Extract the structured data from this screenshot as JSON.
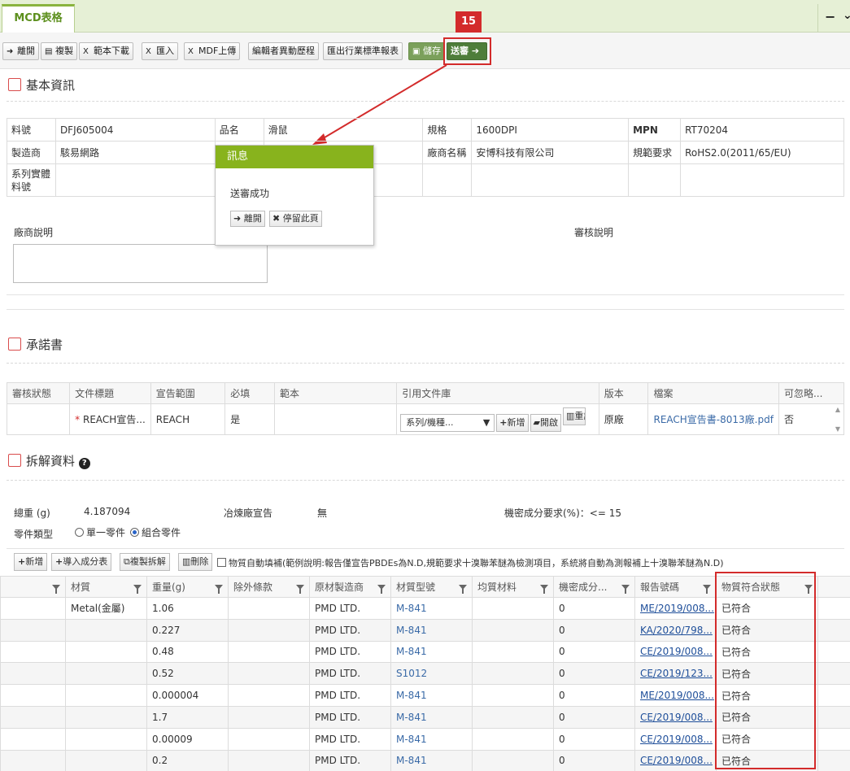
{
  "tab": {
    "title": "MCD表格",
    "minimize": "−",
    "more": "⌄"
  },
  "toolbar": {
    "leave": "離開",
    "copy": "複製",
    "template_download": "範本下載",
    "import": "匯入",
    "mdf_upload": "MDF上傳",
    "edit_history": "編輯者異動歷程",
    "export_industry": "匯出行業標準報表",
    "save": "儲存",
    "submit": "送審",
    "step_badge": "15"
  },
  "basic": {
    "title": "基本資訊",
    "part_no_label": "料號",
    "part_no": "DFJ605004",
    "name_label": "品名",
    "name": "滑鼠",
    "spec_label": "規格",
    "spec": "1600DPI",
    "mpn_label": "MPN",
    "mpn": "RT70204",
    "maker_label": "製造商",
    "maker": "駭易網路",
    "vendor_label": "廠商名稱",
    "vendor": "安博科技有限公司",
    "reg_label": "規範要求",
    "reg": "RoHS2.0(2011/65/EU)",
    "series_label": "系列實體料號",
    "vendor_note_label": "廠商說明",
    "review_note_label": "審核說明"
  },
  "popup": {
    "title": "訊息",
    "message": "送審成功",
    "leave": "離開",
    "stay": "停留此頁"
  },
  "commit": {
    "title": "承諾書",
    "headers": [
      "審核狀態",
      "文件標題",
      "宣告範圍",
      "必填",
      "範本",
      "引用文件庫",
      "版本",
      "檔案",
      "可忽略..."
    ],
    "row": {
      "status": "",
      "doc_title": "REACH宣告...",
      "scope": "REACH",
      "required": "是",
      "template": "",
      "library": "系列/機種...",
      "btn_add": "新增",
      "btn_open": "開啟",
      "btn_reset": "重設",
      "version": "原廠",
      "file": "REACH宣告書-8013廠.pdf",
      "ignore": "否"
    }
  },
  "teardown": {
    "title": "拆解資料",
    "total_weight_label": "總重 (g)",
    "total_weight": "4.187094",
    "smelter_label": "冶煉廠宣告",
    "smelter": "無",
    "confidential_label": "機密成分要求(%)：<= 15",
    "part_type_label": "零件類型",
    "single": "單一零件",
    "combo": "組合零件",
    "btn_add": "新增",
    "btn_import": "導入成分表",
    "btn_copy": "複製拆解",
    "btn_delete": "刪除",
    "auto_fill": "物質自動填補(範例說明:報告僅宣告PBDEs為N.D,規範要求十溴聯苯醚為檢測項目，系統將自動為測報補上十溴聯苯醚為N.D)",
    "headers": [
      "材質",
      "重量(g)",
      "除外條款",
      "原材製造商",
      "材質型號",
      "均質材料",
      "機密成分...",
      "報告號碼",
      "物質符合狀態"
    ],
    "rows": [
      {
        "material": "Metal(金屬)",
        "weight": "1.06",
        "excl": "",
        "maker": "PMD LTD.",
        "model": "M-841",
        "homog": "",
        "conf": "0",
        "report": "ME/2019/008...",
        "status": "已符合"
      },
      {
        "material": "",
        "weight": "0.227",
        "excl": "",
        "maker": "PMD LTD.",
        "model": "M-841",
        "homog": "",
        "conf": "0",
        "report": "KA/2020/798...",
        "status": "已符合"
      },
      {
        "material": "",
        "weight": "0.48",
        "excl": "",
        "maker": "PMD LTD.",
        "model": "M-841",
        "homog": "",
        "conf": "0",
        "report": "CE/2019/008...",
        "status": "已符合"
      },
      {
        "material": "",
        "weight": "0.52",
        "excl": "",
        "maker": "PMD LTD.",
        "model": "S1012",
        "homog": "",
        "conf": "0",
        "report": "CE/2019/123...",
        "status": "已符合"
      },
      {
        "material": "",
        "weight": "0.000004",
        "excl": "",
        "maker": "PMD LTD.",
        "model": "M-841",
        "homog": "",
        "conf": "0",
        "report": "ME/2019/008...",
        "status": "已符合"
      },
      {
        "material": "",
        "weight": "1.7",
        "excl": "",
        "maker": "PMD LTD.",
        "model": "M-841",
        "homog": "",
        "conf": "0",
        "report": "CE/2019/008...",
        "status": "已符合"
      },
      {
        "material": "",
        "weight": "0.00009",
        "excl": "",
        "maker": "PMD LTD.",
        "model": "M-841",
        "homog": "",
        "conf": "0",
        "report": "CE/2019/008...",
        "status": "已符合"
      },
      {
        "material": "",
        "weight": "0.2",
        "excl": "",
        "maker": "PMD LTD.",
        "model": "M-841",
        "homog": "",
        "conf": "0",
        "report": "CE/2019/008...",
        "status": "已符合"
      }
    ]
  },
  "colors": {
    "accent": "#88b31d",
    "highlight": "#d32b2b",
    "link": "#3a6aa7"
  }
}
